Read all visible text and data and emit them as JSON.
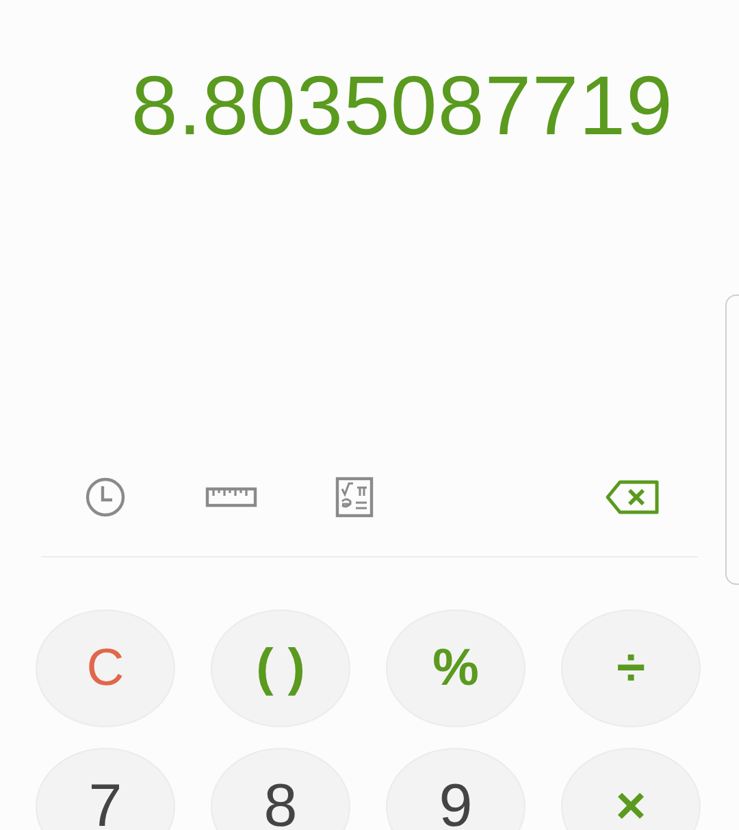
{
  "display": {
    "value": "8.8035087719"
  },
  "keys": [
    {
      "label": "C",
      "kind": "clear"
    },
    {
      "label": "( )",
      "kind": "operator"
    },
    {
      "label": "%",
      "kind": "operator"
    },
    {
      "label": "÷",
      "kind": "operator"
    },
    {
      "label": "7",
      "kind": "digit"
    },
    {
      "label": "8",
      "kind": "digit"
    },
    {
      "label": "9",
      "kind": "digit"
    },
    {
      "label": "×",
      "kind": "operator"
    }
  ]
}
